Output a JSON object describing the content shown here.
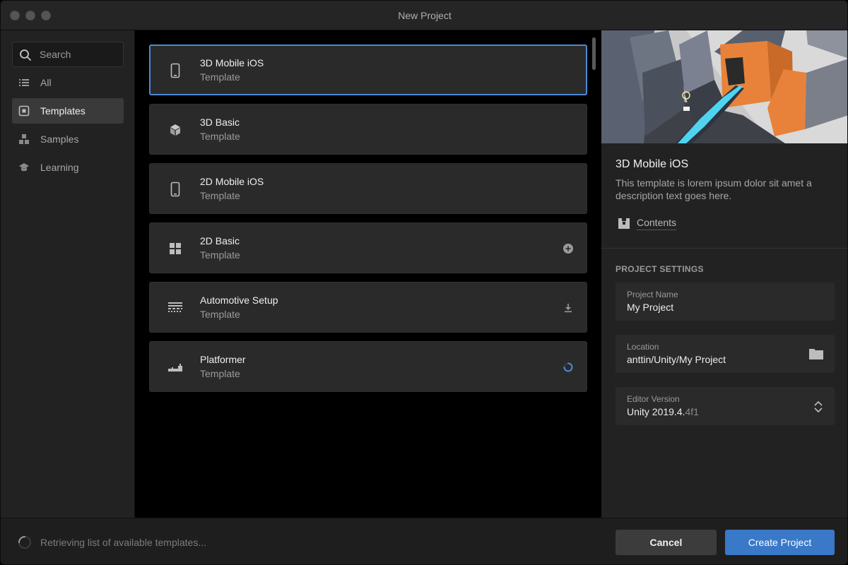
{
  "window": {
    "title": "New Project"
  },
  "sidebar": {
    "search_placeholder": "Search",
    "items": [
      {
        "label": "All",
        "icon": "list-icon",
        "active": false
      },
      {
        "label": "Templates",
        "icon": "template-icon",
        "active": true
      },
      {
        "label": "Samples",
        "icon": "samples-icon",
        "active": false
      },
      {
        "label": "Learning",
        "icon": "graduation-cap-icon",
        "active": false
      }
    ]
  },
  "templates": [
    {
      "name": "3D Mobile iOS",
      "type": "Template",
      "icon": "phone-icon",
      "selected": true,
      "status": ""
    },
    {
      "name": "3D Basic",
      "type": "Template",
      "icon": "cube-icon",
      "selected": false,
      "status": ""
    },
    {
      "name": "2D Mobile iOS",
      "type": "Template",
      "icon": "phone-icon",
      "selected": false,
      "status": ""
    },
    {
      "name": "2D Basic",
      "type": "Template",
      "icon": "grid-icon",
      "selected": false,
      "status": "add-circle-icon"
    },
    {
      "name": "Automotive Setup",
      "type": "Template",
      "icon": "road-icon",
      "selected": false,
      "status": "download-icon"
    },
    {
      "name": "Platformer",
      "type": "Template",
      "icon": "platform-icon",
      "selected": false,
      "status": "loading-spinner-icon"
    }
  ],
  "detail": {
    "title": "3D Mobile iOS",
    "description": "This template is lorem ipsum dolor sit amet a description text goes here.",
    "contents_label": "Contents",
    "section_title": "PROJECT SETTINGS",
    "project_name": {
      "label": "Project Name",
      "value": "My Project"
    },
    "location": {
      "label": "Location",
      "value": "anttin/Unity/My Project"
    },
    "editor_version": {
      "label": "Editor Version",
      "value_main": "Unity 2019.4.",
      "value_dim": "4f1"
    }
  },
  "footer": {
    "status": "Retrieving list of available templates...",
    "cancel_label": "Cancel",
    "create_label": "Create Project"
  },
  "colors": {
    "accent": "#3a78c8",
    "selected_border": "#4a8ad6",
    "preview_orange": "#e8823a",
    "preview_cyan": "#4fd4f0"
  }
}
